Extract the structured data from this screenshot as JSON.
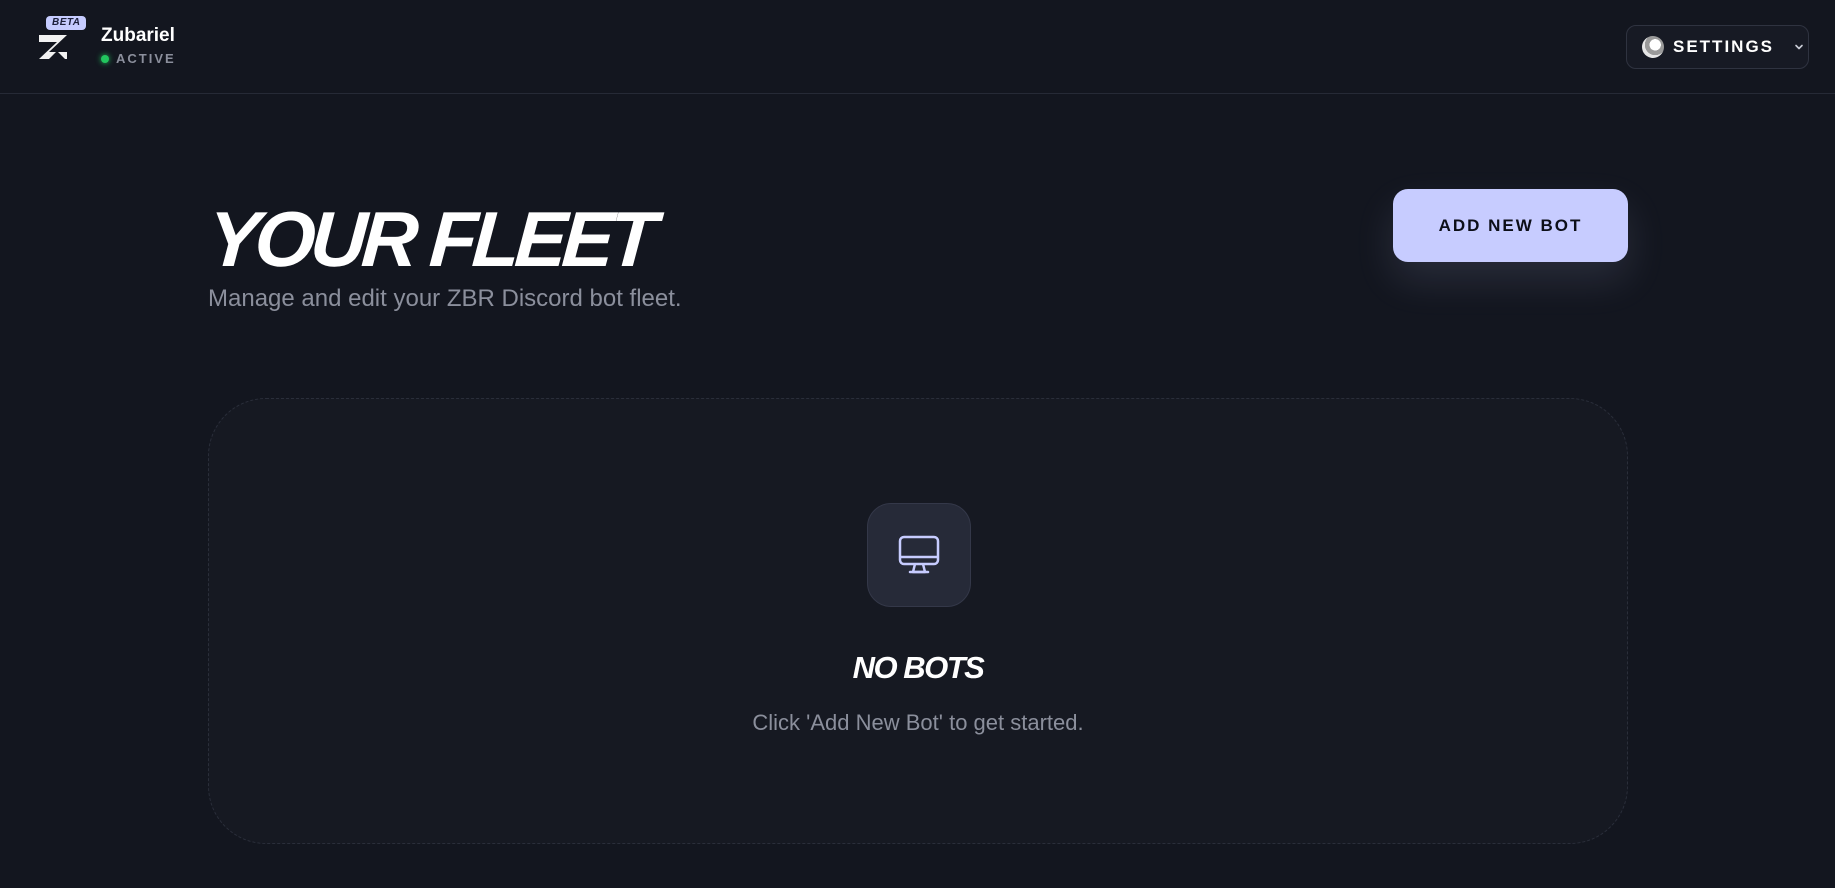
{
  "header": {
    "beta_label": "BETA",
    "app_name": "Zubariel",
    "status_label": "ACTIVE",
    "settings_label": "SETTINGS"
  },
  "main": {
    "title": "YOUR FLEET",
    "subtitle": "Manage and edit your ZBR Discord bot fleet.",
    "add_button_label": "ADD NEW BOT"
  },
  "empty_state": {
    "icon": "monitor-icon",
    "title": "NO BOTS",
    "message": "Click 'Add New Bot' to get started."
  },
  "colors": {
    "background": "#13161f",
    "accent": "#c7ccff",
    "status_active": "#22c55e",
    "muted_text": "#8b8f9c"
  }
}
